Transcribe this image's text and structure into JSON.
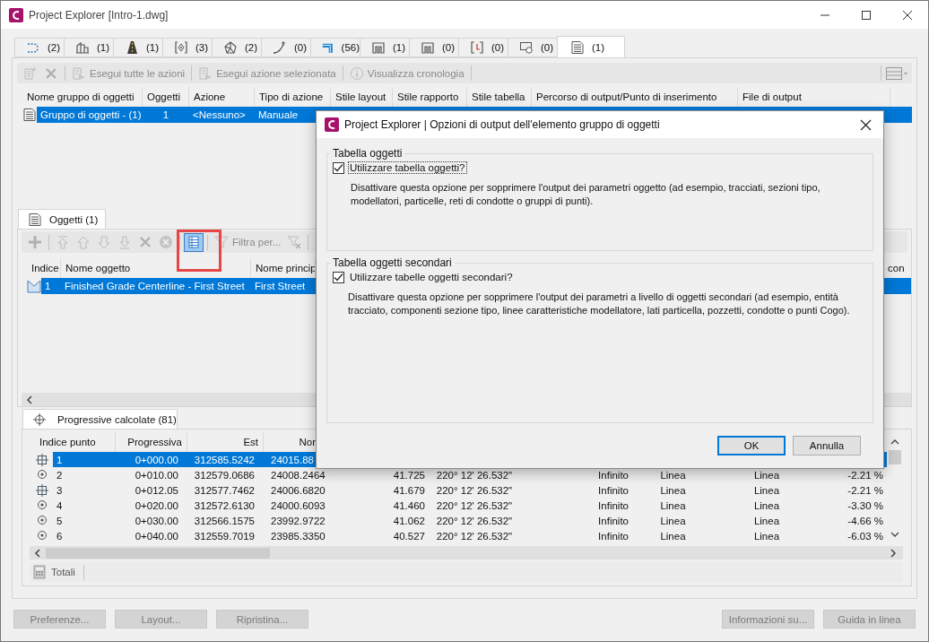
{
  "window": {
    "title": "Project Explorer [Intro-1.dwg]"
  },
  "tabs": [
    {
      "kind": "alignment",
      "label": "(2)",
      "selected": false
    },
    {
      "kind": "building",
      "label": "(1)",
      "selected": false
    },
    {
      "kind": "road",
      "label": "(1)",
      "selected": false
    },
    {
      "kind": "target",
      "label": "(3)",
      "selected": false
    },
    {
      "kind": "surface",
      "label": "(2)",
      "selected": false
    },
    {
      "kind": "feature-line",
      "label": "(0)",
      "selected": false
    },
    {
      "kind": "pipe",
      "label": "(56)",
      "selected": false
    },
    {
      "kind": "structure",
      "label": "(1)",
      "selected": false
    },
    {
      "kind": "structure",
      "label": "(0)",
      "selected": false
    },
    {
      "kind": "bracket",
      "label": "(0)",
      "selected": false
    },
    {
      "kind": "view",
      "label": "(0)",
      "selected": false
    },
    {
      "kind": "list",
      "label": "(1)",
      "selected": true
    }
  ],
  "toolbar": [
    {
      "kind": "new",
      "disabled": true
    },
    {
      "kind": "delete",
      "disabled": true
    },
    {
      "kind": "run",
      "label": "Esegui tutte le azioni",
      "disabled": true
    },
    {
      "kind": "run",
      "label": "Esegui azione selezionata",
      "disabled": true
    },
    {
      "kind": "info",
      "label": "Visualizza cronologia",
      "disabled": true
    }
  ],
  "groups_table": {
    "columns": [
      "Nome gruppo di oggetti",
      "Oggetti",
      "Azione",
      "Tipo di azione",
      "Stile layout",
      "Stile rapporto",
      "Stile tabella",
      "Percorso di output/Punto di inserimento",
      "File di output"
    ],
    "rows": [
      {
        "selected": true,
        "cells": [
          "Gruppo di oggetti - (1)",
          "1",
          "<Nessuno>",
          "Manuale"
        ]
      }
    ]
  },
  "objects_panel": {
    "tab": "Oggetti (1)",
    "toolbar": [
      {
        "kind": "add",
        "disabled": true,
        "active": false,
        "separator_after": true
      },
      {
        "kind": "top",
        "disabled": true,
        "active": false,
        "separator_after": false
      },
      {
        "kind": "up",
        "disabled": true,
        "active": false,
        "separator_after": false
      },
      {
        "kind": "down",
        "disabled": true,
        "active": false,
        "separator_after": false
      },
      {
        "kind": "bottom",
        "disabled": true,
        "active": false,
        "separator_after": false
      },
      {
        "kind": "remove",
        "disabled": true,
        "active": false,
        "separator_after": false
      },
      {
        "kind": "cancel",
        "disabled": true,
        "active": false,
        "separator_after": true
      },
      {
        "kind": "table",
        "disabled": false,
        "active": true,
        "separator_after": true
      },
      {
        "kind": "filter",
        "label": "Filtra per...",
        "disabled": true,
        "active": false,
        "separator_after": false
      },
      {
        "kind": "filter-clear",
        "disabled": true,
        "active": false,
        "separator_after": true
      }
    ],
    "columns": [
      "Indice",
      "Nome oggetto",
      "Nome princip"
    ],
    "far_column": "con",
    "rows": [
      {
        "selected": true,
        "cells": [
          "1",
          "Finished Grade Centerline - First Street",
          "First Street"
        ]
      }
    ]
  },
  "stations_panel": {
    "tab": "Progressive calcolate (81)",
    "columns": [
      "Indice punto",
      "Progressiva",
      "Est",
      "Nor"
    ],
    "rows": [
      {
        "kind": "crosshair",
        "selected": true,
        "cells": [
          "1",
          "0+000.00",
          "312585.5242",
          "24015.88"
        ]
      },
      {
        "kind": "point",
        "selected": false,
        "cells": [
          "2",
          "0+010.00",
          "312579.0686",
          "24008.2464",
          "41.725",
          "220° 12' 26.532\"",
          "Infinito",
          "Linea",
          "Linea",
          "-2.21 %"
        ]
      },
      {
        "kind": "crosshair",
        "selected": false,
        "cells": [
          "3",
          "0+012.05",
          "312577.7462",
          "24006.6820",
          "41.679",
          "220° 12' 26.532\"",
          "Infinito",
          "Linea",
          "Linea",
          "-2.21 %"
        ]
      },
      {
        "kind": "point",
        "selected": false,
        "cells": [
          "4",
          "0+020.00",
          "312572.6130",
          "24000.6093",
          "41.460",
          "220° 12' 26.532\"",
          "Infinito",
          "Linea",
          "Linea",
          "-3.30 %"
        ]
      },
      {
        "kind": "point",
        "selected": false,
        "cells": [
          "5",
          "0+030.00",
          "312566.1575",
          "23992.9722",
          "41.062",
          "220° 12' 26.532\"",
          "Infinito",
          "Linea",
          "Linea",
          "-4.66 %"
        ]
      },
      {
        "kind": "point",
        "selected": false,
        "cells": [
          "6",
          "0+040.00",
          "312559.7019",
          "23985.3350",
          "40.527",
          "220° 12' 26.532\"",
          "Infinito",
          "Linea",
          "Linea",
          "-6.03 %"
        ]
      }
    ],
    "totals": "Totali"
  },
  "buttons_left": [
    {
      "label": "Preferenze...",
      "disabled": true
    },
    {
      "label": "Layout...",
      "disabled": true
    },
    {
      "label": "Ripristina...",
      "disabled": true
    }
  ],
  "buttons_right": [
    {
      "label": "Informazioni su...",
      "disabled": true
    },
    {
      "label": "Guida in linea",
      "disabled": true
    }
  ],
  "dialog": {
    "title": "Project Explorer | Opzioni di output dell'elemento gruppo di oggetti",
    "sections": [
      {
        "title": "Tabella oggetti",
        "option": {
          "label": "Utilizzare tabella oggetti?",
          "checked": true,
          "focused": true
        },
        "description": "Disattivare questa opzione per sopprimere l'output dei parametri oggetto (ad esempio, tracciati, sezioni tipo, modellatori, particelle, reti di condotte o gruppi di punti)."
      },
      {
        "title": "Tabella oggetti secondari",
        "option": {
          "label": "Utilizzare tabelle oggetti secondari?",
          "checked": true,
          "focused": false
        },
        "description": "Disattivare questa opzione per sopprimere l'output dei parametri a livello di oggetti secondari (ad esempio, entità tracciato, componenti sezione tipo, linee caratteristiche modellatore, lati particella, pozzetti, condotte o punti Cogo)."
      }
    ],
    "buttons": [
      {
        "label": "OK",
        "default": true
      },
      {
        "label": "Annulla",
        "default": false
      }
    ]
  }
}
